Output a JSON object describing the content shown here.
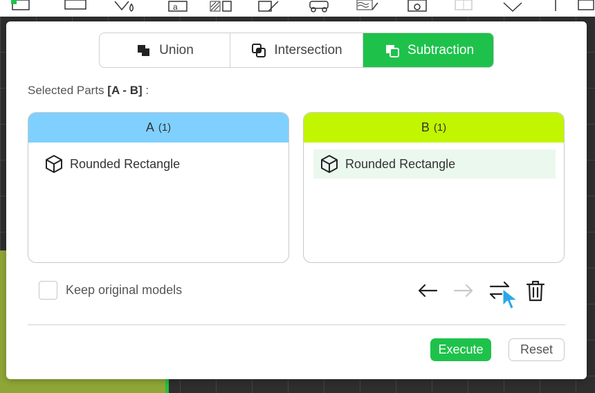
{
  "toolbar": {
    "icons": [
      "panel-icon",
      "rectangle-icon",
      "paint-fill-icon",
      "text-icon",
      "texture-icon",
      "shape-edit-icon",
      "vehicle-icon",
      "wave-icon",
      "device-icon",
      "cube-icon",
      "diamond-icon",
      "line-icon",
      "export-icon"
    ]
  },
  "dialog": {
    "tabs": [
      {
        "label": "Union",
        "icon": "union-icon",
        "active": false
      },
      {
        "label": "Intersection",
        "icon": "intersection-icon",
        "active": false
      },
      {
        "label": "Subtraction",
        "icon": "subtraction-icon",
        "active": true
      }
    ],
    "selected_parts_prefix": "Selected Parts ",
    "selected_parts_formula": "[A - B]",
    "selected_parts_suffix": " :",
    "part_a": {
      "title": "A",
      "count": "(1)",
      "items": [
        {
          "label": "Rounded Rectangle",
          "icon": "cube-outline-icon"
        }
      ]
    },
    "part_b": {
      "title": "B",
      "count": "(1)",
      "items": [
        {
          "label": "Rounded Rectangle",
          "icon": "cube-outline-icon"
        }
      ]
    },
    "keep_original_label": "Keep original models",
    "keep_original_checked": false,
    "actions": [
      "move-to-a-arrow-icon",
      "move-to-b-arrow-icon",
      "swap-icon",
      "trash-icon"
    ],
    "execute_label": "Execute",
    "reset_label": "Reset"
  },
  "colors": {
    "accent_green": "#1ec24b",
    "part_a_header": "#7fd0ff",
    "part_b_header": "#c2f500"
  }
}
